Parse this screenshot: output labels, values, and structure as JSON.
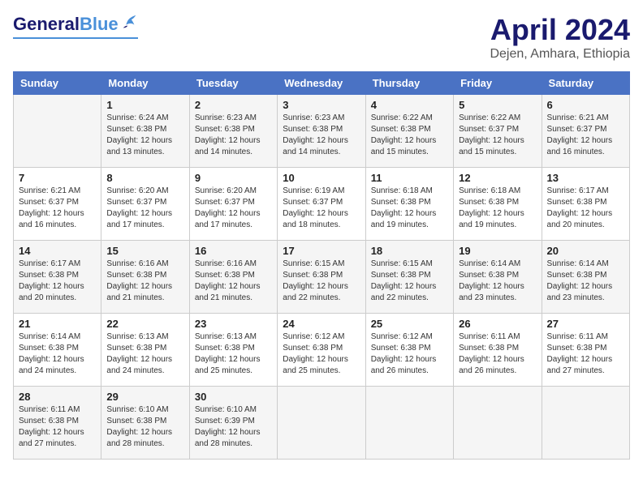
{
  "header": {
    "logo_general": "General",
    "logo_blue": "Blue",
    "title": "April 2024",
    "subtitle": "Dejen, Amhara, Ethiopia"
  },
  "calendar": {
    "weekdays": [
      "Sunday",
      "Monday",
      "Tuesday",
      "Wednesday",
      "Thursday",
      "Friday",
      "Saturday"
    ],
    "weeks": [
      [
        {
          "day": "",
          "info": ""
        },
        {
          "day": "1",
          "info": "Sunrise: 6:24 AM\nSunset: 6:38 PM\nDaylight: 12 hours\nand 13 minutes."
        },
        {
          "day": "2",
          "info": "Sunrise: 6:23 AM\nSunset: 6:38 PM\nDaylight: 12 hours\nand 14 minutes."
        },
        {
          "day": "3",
          "info": "Sunrise: 6:23 AM\nSunset: 6:38 PM\nDaylight: 12 hours\nand 14 minutes."
        },
        {
          "day": "4",
          "info": "Sunrise: 6:22 AM\nSunset: 6:38 PM\nDaylight: 12 hours\nand 15 minutes."
        },
        {
          "day": "5",
          "info": "Sunrise: 6:22 AM\nSunset: 6:37 PM\nDaylight: 12 hours\nand 15 minutes."
        },
        {
          "day": "6",
          "info": "Sunrise: 6:21 AM\nSunset: 6:37 PM\nDaylight: 12 hours\nand 16 minutes."
        }
      ],
      [
        {
          "day": "7",
          "info": "Sunrise: 6:21 AM\nSunset: 6:37 PM\nDaylight: 12 hours\nand 16 minutes."
        },
        {
          "day": "8",
          "info": "Sunrise: 6:20 AM\nSunset: 6:37 PM\nDaylight: 12 hours\nand 17 minutes."
        },
        {
          "day": "9",
          "info": "Sunrise: 6:20 AM\nSunset: 6:37 PM\nDaylight: 12 hours\nand 17 minutes."
        },
        {
          "day": "10",
          "info": "Sunrise: 6:19 AM\nSunset: 6:37 PM\nDaylight: 12 hours\nand 18 minutes."
        },
        {
          "day": "11",
          "info": "Sunrise: 6:18 AM\nSunset: 6:38 PM\nDaylight: 12 hours\nand 19 minutes."
        },
        {
          "day": "12",
          "info": "Sunrise: 6:18 AM\nSunset: 6:38 PM\nDaylight: 12 hours\nand 19 minutes."
        },
        {
          "day": "13",
          "info": "Sunrise: 6:17 AM\nSunset: 6:38 PM\nDaylight: 12 hours\nand 20 minutes."
        }
      ],
      [
        {
          "day": "14",
          "info": "Sunrise: 6:17 AM\nSunset: 6:38 PM\nDaylight: 12 hours\nand 20 minutes."
        },
        {
          "day": "15",
          "info": "Sunrise: 6:16 AM\nSunset: 6:38 PM\nDaylight: 12 hours\nand 21 minutes."
        },
        {
          "day": "16",
          "info": "Sunrise: 6:16 AM\nSunset: 6:38 PM\nDaylight: 12 hours\nand 21 minutes."
        },
        {
          "day": "17",
          "info": "Sunrise: 6:15 AM\nSunset: 6:38 PM\nDaylight: 12 hours\nand 22 minutes."
        },
        {
          "day": "18",
          "info": "Sunrise: 6:15 AM\nSunset: 6:38 PM\nDaylight: 12 hours\nand 22 minutes."
        },
        {
          "day": "19",
          "info": "Sunrise: 6:14 AM\nSunset: 6:38 PM\nDaylight: 12 hours\nand 23 minutes."
        },
        {
          "day": "20",
          "info": "Sunrise: 6:14 AM\nSunset: 6:38 PM\nDaylight: 12 hours\nand 23 minutes."
        }
      ],
      [
        {
          "day": "21",
          "info": "Sunrise: 6:14 AM\nSunset: 6:38 PM\nDaylight: 12 hours\nand 24 minutes."
        },
        {
          "day": "22",
          "info": "Sunrise: 6:13 AM\nSunset: 6:38 PM\nDaylight: 12 hours\nand 24 minutes."
        },
        {
          "day": "23",
          "info": "Sunrise: 6:13 AM\nSunset: 6:38 PM\nDaylight: 12 hours\nand 25 minutes."
        },
        {
          "day": "24",
          "info": "Sunrise: 6:12 AM\nSunset: 6:38 PM\nDaylight: 12 hours\nand 25 minutes."
        },
        {
          "day": "25",
          "info": "Sunrise: 6:12 AM\nSunset: 6:38 PM\nDaylight: 12 hours\nand 26 minutes."
        },
        {
          "day": "26",
          "info": "Sunrise: 6:11 AM\nSunset: 6:38 PM\nDaylight: 12 hours\nand 26 minutes."
        },
        {
          "day": "27",
          "info": "Sunrise: 6:11 AM\nSunset: 6:38 PM\nDaylight: 12 hours\nand 27 minutes."
        }
      ],
      [
        {
          "day": "28",
          "info": "Sunrise: 6:11 AM\nSunset: 6:38 PM\nDaylight: 12 hours\nand 27 minutes."
        },
        {
          "day": "29",
          "info": "Sunrise: 6:10 AM\nSunset: 6:38 PM\nDaylight: 12 hours\nand 28 minutes."
        },
        {
          "day": "30",
          "info": "Sunrise: 6:10 AM\nSunset: 6:39 PM\nDaylight: 12 hours\nand 28 minutes."
        },
        {
          "day": "",
          "info": ""
        },
        {
          "day": "",
          "info": ""
        },
        {
          "day": "",
          "info": ""
        },
        {
          "day": "",
          "info": ""
        }
      ]
    ]
  }
}
